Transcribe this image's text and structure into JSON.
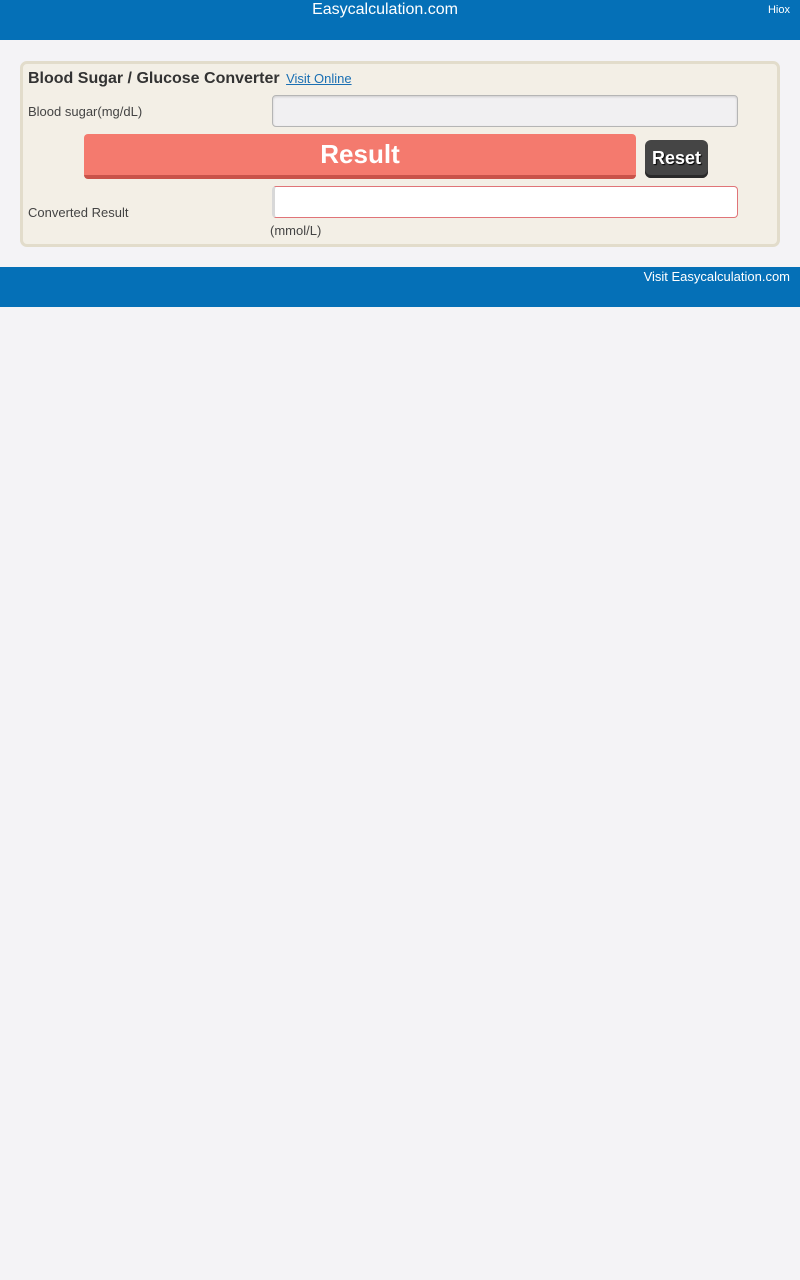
{
  "header": {
    "brand": "Easycalculation.com",
    "hiox": "Hiox"
  },
  "converter": {
    "title": "Blood Sugar / Glucose Converter",
    "visit_online": "Visit Online",
    "input_label": "Blood sugar(mg/dL)",
    "input_value": "",
    "result_button": "Result",
    "reset_button": "Reset",
    "output_label": "Converted Result",
    "output_value": "",
    "output_unit": "(mmol/L)"
  },
  "footer": {
    "visit_site": "Visit Easycalculation.com"
  },
  "colors": {
    "header_bg": "#0570b7",
    "result_button": "#f47a6e",
    "reset_button": "#454545",
    "panel_bg": "#f3efe6"
  }
}
